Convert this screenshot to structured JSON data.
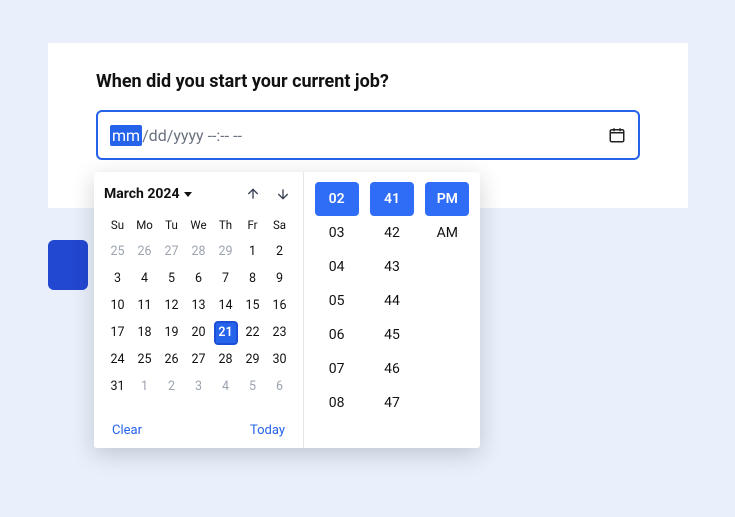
{
  "question": "When did you start your current job?",
  "input": {
    "mm": "mm",
    "rest": "/dd/yyyy --:-- --"
  },
  "calendar": {
    "month_label": "March 2024",
    "dows": [
      "Su",
      "Mo",
      "Tu",
      "We",
      "Th",
      "Fr",
      "Sa"
    ],
    "weeks": [
      [
        {
          "n": 25,
          "o": true
        },
        {
          "n": 26,
          "o": true
        },
        {
          "n": 27,
          "o": true
        },
        {
          "n": 28,
          "o": true
        },
        {
          "n": 29,
          "o": true
        },
        {
          "n": 1
        },
        {
          "n": 2
        }
      ],
      [
        {
          "n": 3
        },
        {
          "n": 4
        },
        {
          "n": 5
        },
        {
          "n": 6
        },
        {
          "n": 7
        },
        {
          "n": 8
        },
        {
          "n": 9
        }
      ],
      [
        {
          "n": 10
        },
        {
          "n": 11
        },
        {
          "n": 12
        },
        {
          "n": 13
        },
        {
          "n": 14
        },
        {
          "n": 15
        },
        {
          "n": 16
        }
      ],
      [
        {
          "n": 17
        },
        {
          "n": 18
        },
        {
          "n": 19
        },
        {
          "n": 20
        },
        {
          "n": 21,
          "today": true
        },
        {
          "n": 22
        },
        {
          "n": 23
        }
      ],
      [
        {
          "n": 24
        },
        {
          "n": 25
        },
        {
          "n": 26
        },
        {
          "n": 27
        },
        {
          "n": 28
        },
        {
          "n": 29
        },
        {
          "n": 30
        }
      ],
      [
        {
          "n": 31
        },
        {
          "n": 1,
          "o": true
        },
        {
          "n": 2,
          "o": true
        },
        {
          "n": 3,
          "o": true
        },
        {
          "n": 4,
          "o": true
        },
        {
          "n": 5,
          "o": true
        },
        {
          "n": 6,
          "o": true
        }
      ]
    ],
    "clear": "Clear",
    "today": "Today"
  },
  "time": {
    "hours": [
      "02",
      "03",
      "04",
      "05",
      "06",
      "07",
      "08"
    ],
    "minutes": [
      "41",
      "42",
      "43",
      "44",
      "45",
      "46",
      "47"
    ],
    "ampm": [
      "PM",
      "AM"
    ],
    "selected_hour": "02",
    "selected_minute": "41",
    "selected_ampm": "PM"
  }
}
